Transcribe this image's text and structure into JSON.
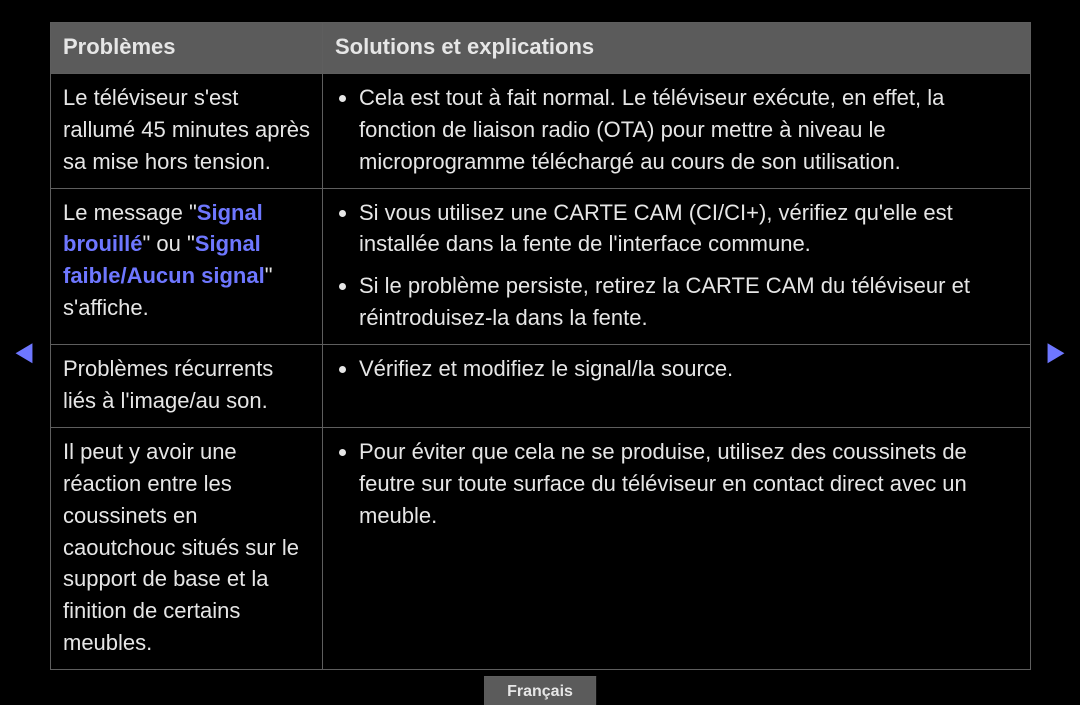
{
  "headers": {
    "problems": "Problèmes",
    "solutions": "Solutions et explications"
  },
  "rows": [
    {
      "problem": {
        "text": "Le téléviseur s'est rallumé 45 minutes après sa mise hors tension."
      },
      "solutions": [
        "Cela est tout à fait normal. Le téléviseur exécute, en effet, la fonction de liaison radio (OTA) pour mettre à niveau le microprogramme téléchargé au cours de son utilisation."
      ]
    },
    {
      "problem": {
        "segments": [
          {
            "text": "Le message \""
          },
          {
            "text": "Signal brouillé",
            "hl": true
          },
          {
            "text": "\" ou \""
          },
          {
            "text": "Signal faible/Aucun signal",
            "hl": true
          },
          {
            "text": "\" s'affiche."
          }
        ]
      },
      "solutions": [
        "Si vous utilisez une CARTE CAM (CI/CI+), vérifiez qu'elle est installée dans la fente de l'interface commune.",
        "Si le problème persiste, retirez la CARTE CAM du téléviseur et réintroduisez-la dans la fente."
      ]
    },
    {
      "problem": {
        "text": "Problèmes récurrents liés à l'image/au son."
      },
      "solutions": [
        "Vérifiez et modifiez le signal/la source."
      ]
    },
    {
      "problem": {
        "text": "Il peut y avoir une réaction entre les coussinets en caoutchouc situés sur le support de base et la finition de certains meubles."
      },
      "solutions": [
        "Pour éviter que cela ne se produise, utilisez des coussinets de feutre sur toute surface du téléviseur en contact direct avec un meuble."
      ]
    }
  ],
  "language_label": "Français",
  "arrows": {
    "left": "◀",
    "right": "▶"
  }
}
